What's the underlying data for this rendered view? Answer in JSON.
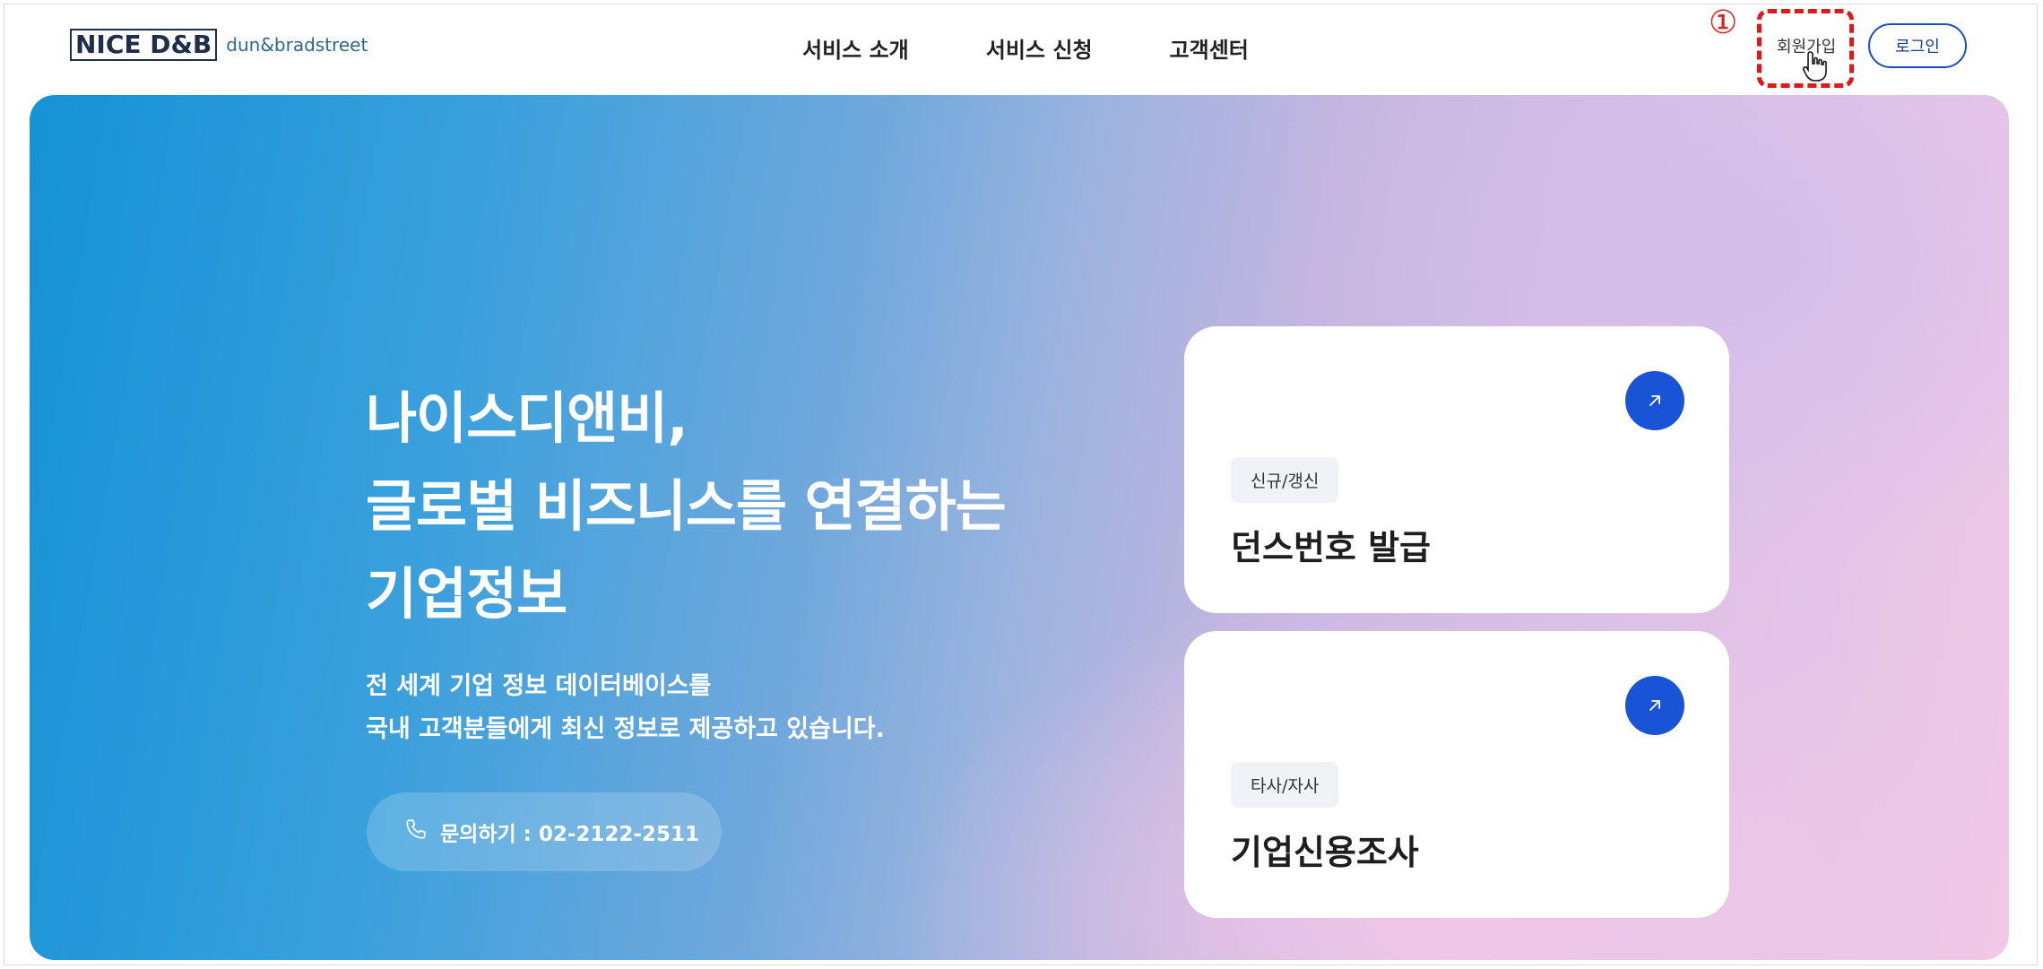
{
  "header": {
    "logo_main": "NICE D&B",
    "logo_sub": "dun&bradstreet",
    "nav": [
      "서비스 소개",
      "서비스 신청",
      "고객센터"
    ],
    "annotation_number": "①",
    "signup_label": "회원가입",
    "login_label": "로그인"
  },
  "hero": {
    "title_lines": [
      "나이스디앤비,",
      "글로벌 비즈니스를 연결하는",
      "기업정보"
    ],
    "subtitle_lines": [
      "전 세계 기업 정보 데이터베이스를",
      "국내 고객분들에게 최신 정보로 제공하고 있습니다."
    ],
    "contact": "문의하기 : 02-2122-2511"
  },
  "cards": [
    {
      "tag": "신규/갱신",
      "title": "던스번호 발급"
    },
    {
      "tag": "타사/자사",
      "title": "기업신용조사"
    }
  ],
  "colors": {
    "accent": "#1a54d6",
    "annotation": "#e01818"
  }
}
